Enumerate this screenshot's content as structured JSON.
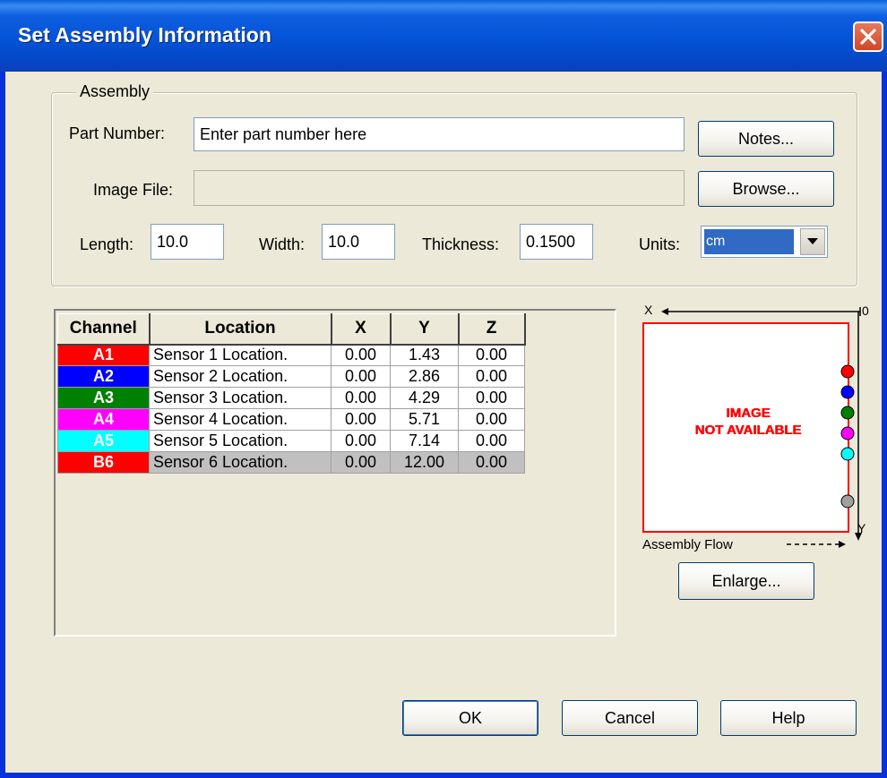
{
  "window": {
    "title": "Set Assembly Information"
  },
  "assembly": {
    "group_label": "Assembly",
    "part_number_label": "Part Number:",
    "part_number_value": "Enter part number here",
    "image_file_label": "Image File:",
    "image_file_value": "",
    "length_label": "Length:",
    "length_value": "10.0",
    "width_label": "Width:",
    "width_value": "10.0",
    "thickness_label": "Thickness:",
    "thickness_value": "0.1500",
    "units_label": "Units:",
    "units_value": "cm",
    "notes_button": "Notes...",
    "browse_button": "Browse..."
  },
  "grid": {
    "headers": [
      "Channel",
      "Location",
      "X",
      "Y",
      "Z"
    ],
    "rows": [
      {
        "channel": "A1",
        "color": "#ff0000",
        "location": "Sensor 1 Location.",
        "x": "0.00",
        "y": "1.43",
        "z": "0.00"
      },
      {
        "channel": "A2",
        "color": "#0000ff",
        "location": "Sensor 2 Location.",
        "x": "0.00",
        "y": "2.86",
        "z": "0.00"
      },
      {
        "channel": "A3",
        "color": "#008000",
        "location": "Sensor 3 Location.",
        "x": "0.00",
        "y": "4.29",
        "z": "0.00"
      },
      {
        "channel": "A4",
        "color": "#ff00ff",
        "location": "Sensor 4 Location.",
        "x": "0.00",
        "y": "5.71",
        "z": "0.00"
      },
      {
        "channel": "A5",
        "color": "#00ffff",
        "location": "Sensor 5 Location.",
        "x": "0.00",
        "y": "7.14",
        "z": "0.00"
      },
      {
        "channel": "B6",
        "color": "#ff0000",
        "location": "Sensor 6 Location.",
        "x": "0.00",
        "y": "12.00",
        "z": "0.00"
      }
    ]
  },
  "preview": {
    "x_axis_label": "X",
    "origin_label": "0",
    "y_axis_label": "Y",
    "not_available_line1": "IMAGE",
    "not_available_line2": "NOT AVAILABLE",
    "flow_label": "Assembly Flow",
    "enlarge_button": "Enlarge...",
    "marker_colors": [
      "#ff0000",
      "#0000ff",
      "#008000",
      "#ff00ff",
      "#00ffff",
      "#808080"
    ]
  },
  "footer": {
    "ok_button": "OK",
    "cancel_button": "Cancel",
    "help_button": "Help"
  }
}
